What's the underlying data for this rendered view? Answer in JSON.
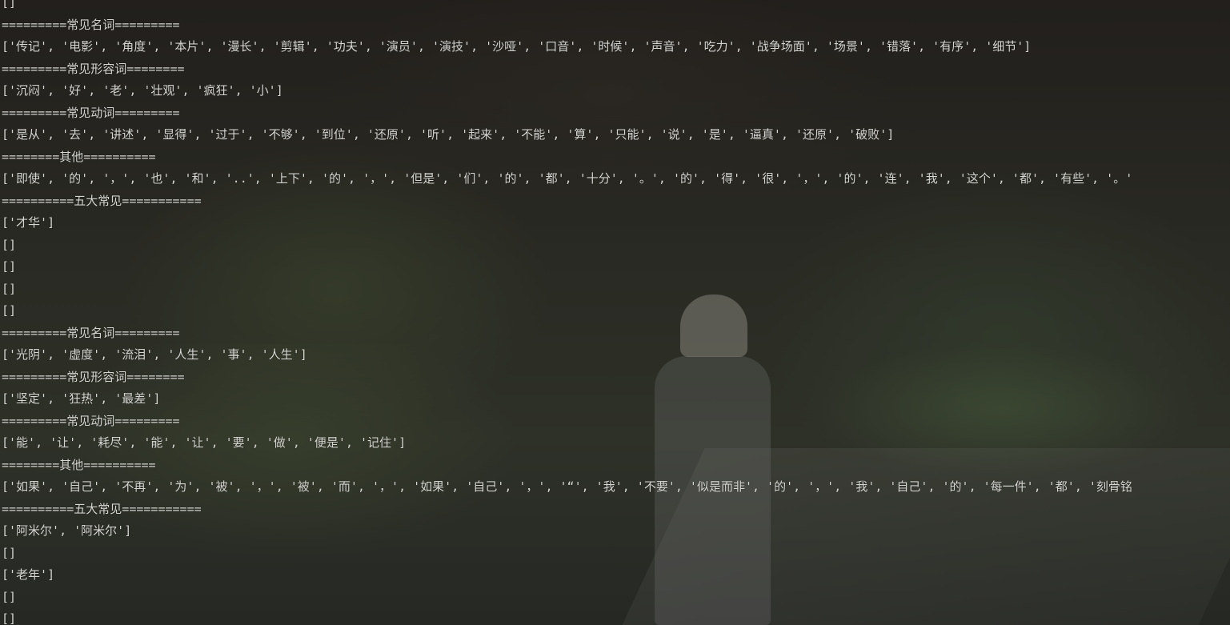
{
  "console": {
    "lines": [
      "[]",
      "=========常见名词=========",
      "['传记', '电影', '角度', '本片', '漫长', '剪辑', '功夫', '演员', '演技', '沙哑', '口音', '时候', '声音', '吃力', '战争场面', '场景', '错落', '有序', '细节']",
      "=========常见形容词========",
      "['沉闷', '好', '老', '壮观', '疯狂', '小']",
      "=========常见动词=========",
      "['是从', '去', '讲述', '显得', '过于', '不够', '到位', '还原', '听', '起来', '不能', '算', '只能', '说', '是', '逼真', '还原', '破败']",
      "========其他==========",
      "['即使', '的', '，', '也', '和', '..', '上下', '的', '，', '但是', '们', '的', '都', '十分', '。', '的', '得', '很', '，', '的', '连', '我', '这个', '都', '有些', '。'",
      "==========五大常见===========",
      "['才华']",
      "[]",
      "[]",
      "[]",
      "[]",
      "=========常见名词=========",
      "['光阴', '虚度', '流泪', '人生', '事', '人生']",
      "=========常见形容词========",
      "['坚定', '狂热', '最差']",
      "=========常见动词=========",
      "['能', '让', '耗尽', '能', '让', '要', '做', '便是', '记住']",
      "========其他==========",
      "['如果', '自己', '不再', '为', '被', '，', '被', '而', '，', '如果', '自己', '，', '“', '我', '不要', '似是而非', '的', '，', '我', '自己', '的', '每一件', '都', '刻骨铭",
      "==========五大常见===========",
      "['阿米尔', '阿米尔']",
      "[]",
      "['老年']",
      "[]",
      "[]"
    ]
  }
}
